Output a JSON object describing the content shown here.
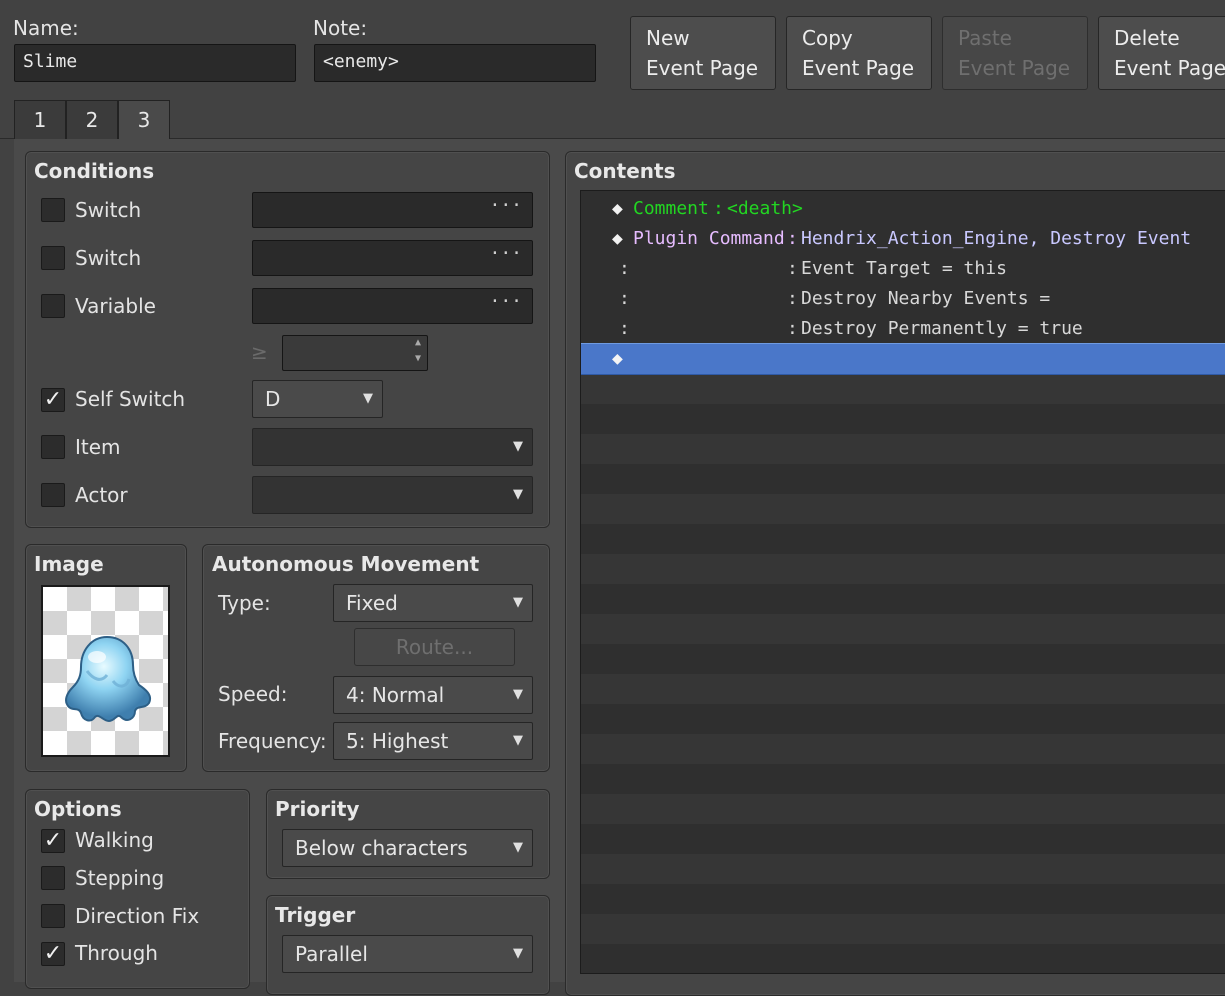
{
  "header": {
    "name_label": "Name:",
    "name_value": "Slime",
    "note_label": "Note:",
    "note_value": "<enemy>"
  },
  "toolbar": {
    "buttons": [
      {
        "line1": "New",
        "line2": "Event Page",
        "enabled": true
      },
      {
        "line1": "Copy",
        "line2": "Event Page",
        "enabled": true
      },
      {
        "line1": "Paste",
        "line2": "Event Page",
        "enabled": false
      },
      {
        "line1": "Delete",
        "line2": "Event Page",
        "enabled": true
      }
    ]
  },
  "tabs": [
    "1",
    "2",
    "3"
  ],
  "active_tab": "3",
  "conditions": {
    "title": "Conditions",
    "switch1_label": "Switch",
    "switch2_label": "Switch",
    "variable_label": "Variable",
    "ge_symbol": "≥",
    "ellipsis": "···",
    "self_switch_label": "Self Switch",
    "self_switch_value": "D",
    "item_label": "Item",
    "actor_label": "Actor",
    "checked": {
      "switch1": false,
      "switch2": false,
      "variable": false,
      "self_switch": true,
      "item": false,
      "actor": false
    }
  },
  "image": {
    "title": "Image",
    "icon": "slime-sprite"
  },
  "movement": {
    "title": "Autonomous Movement",
    "type_label": "Type:",
    "type_value": "Fixed",
    "route_label": "Route...",
    "speed_label": "Speed:",
    "speed_value": "4: Normal",
    "frequency_label": "Frequency:",
    "frequency_value": "5: Highest"
  },
  "options": {
    "title": "Options",
    "items": [
      {
        "label": "Walking",
        "checked": true
      },
      {
        "label": "Stepping",
        "checked": false
      },
      {
        "label": "Direction Fix",
        "checked": false
      },
      {
        "label": "Through",
        "checked": true
      }
    ]
  },
  "priority": {
    "title": "Priority",
    "value": "Below characters"
  },
  "trigger": {
    "title": "Trigger",
    "value": "Parallel"
  },
  "contents": {
    "title": "Contents",
    "lines": [
      {
        "marker": "◆",
        "name": "Comment",
        "sep": ":",
        "value": "<death>"
      },
      {
        "marker": "◆",
        "name": "Plugin Command",
        "sep": ":",
        "value": "Hendrix_Action_Engine, Destroy Event"
      },
      {
        "marker": ":",
        "name": "",
        "sep": ":",
        "value": "Event Target = this"
      },
      {
        "marker": ":",
        "name": "",
        "sep": ":",
        "value": "Destroy Nearby Events ="
      },
      {
        "marker": ":",
        "name": "",
        "sep": ":",
        "value": "Destroy Permanently = true"
      },
      {
        "marker": "◆",
        "name": "",
        "sep": "",
        "value": ""
      }
    ]
  },
  "colors": {
    "comment": "#22d622",
    "plugin_name": "#e6bcff",
    "plugin_value": "#c9c8ff",
    "selection": "#4a77c9"
  }
}
